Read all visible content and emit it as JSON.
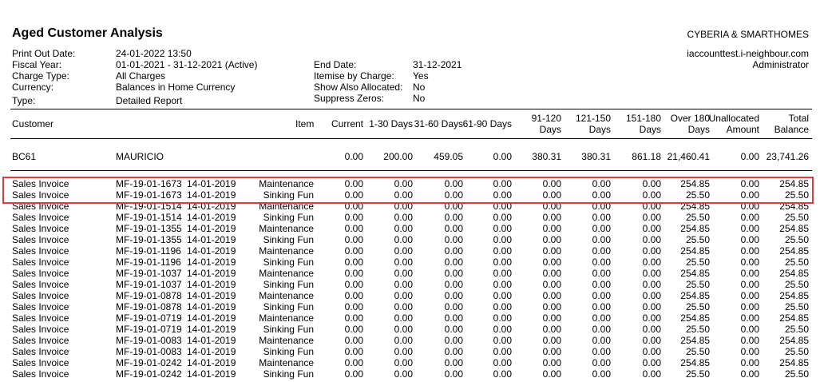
{
  "report": {
    "title": "Aged Customer Analysis",
    "company": "CYBERIA & SMARTHOMES",
    "site": "iaccounttest.i-neighbour.com",
    "role": "Administrator"
  },
  "meta_left": [
    {
      "label": "Print Out Date:",
      "value": "24-01-2022 13:50"
    },
    {
      "label": "Fiscal Year:",
      "value": "01-01-2021 - 31-12-2021 (Active)"
    },
    {
      "label": "Charge Type:",
      "value": "All Charges"
    },
    {
      "label": "Currency:",
      "value": "Balances in Home Currency"
    },
    {
      "label": "Type:",
      "value": "Detailed Report"
    }
  ],
  "meta_mid": [
    {
      "label": "End Date:",
      "value": "31-12-2021"
    },
    {
      "label": "Itemise by Charge:",
      "value": "Yes"
    },
    {
      "label": "Show Also Allocated:",
      "value": "No"
    },
    {
      "label": "Suppress Zeros:",
      "value": "No"
    }
  ],
  "columns": {
    "customer": "Customer",
    "item": "Item",
    "current": "Current",
    "d1_30": "1-30 Days",
    "d31_60": "31-60 Days",
    "d61_90": "61-90 Days",
    "d91_120_a": "91-120",
    "d91_120_b": "Days",
    "d121_150_a": "121-150",
    "d121_150_b": "Days",
    "d151_180_a": "151-180",
    "d151_180_b": "Days",
    "over180_a": "Over 180",
    "over180_b": "Days",
    "unalloc_a": "Unallocated",
    "unalloc_b": "Amount",
    "total_a": "Total",
    "total_b": "Balance"
  },
  "customer": {
    "code": "BC61",
    "name": "MAURICIO",
    "current": "0.00",
    "d1_30": "200.00",
    "d31_60": "459.05",
    "d61_90": "0.00",
    "d91_120": "380.31",
    "d121_150": "380.31",
    "d151_180": "861.18",
    "over180": "21,460.41",
    "unalloc": "0.00",
    "total": "23,741.26"
  },
  "rows": [
    {
      "type": "Sales Invoice",
      "ref": "MF-19-01-1673",
      "date": "14-01-2019",
      "item": "Maintenance",
      "c": "0.00",
      "a": "0.00",
      "b": "0.00",
      "d": "0.00",
      "e": "0.00",
      "f": "0.00",
      "g": "0.00",
      "o": "254.85",
      "u": "0.00",
      "t": "254.85"
    },
    {
      "type": "Sales Invoice",
      "ref": "MF-19-01-1673",
      "date": "14-01-2019",
      "item": "Sinking Fun",
      "c": "0.00",
      "a": "0.00",
      "b": "0.00",
      "d": "0.00",
      "e": "0.00",
      "f": "0.00",
      "g": "0.00",
      "o": "25.50",
      "u": "0.00",
      "t": "25.50"
    },
    {
      "type": "Sales Invoice",
      "ref": "MF-19-01-1514",
      "date": "14-01-2019",
      "item": "Maintenance",
      "c": "0.00",
      "a": "0.00",
      "b": "0.00",
      "d": "0.00",
      "e": "0.00",
      "f": "0.00",
      "g": "0.00",
      "o": "254.85",
      "u": "0.00",
      "t": "254.85"
    },
    {
      "type": "Sales Invoice",
      "ref": "MF-19-01-1514",
      "date": "14-01-2019",
      "item": "Sinking Fun",
      "c": "0.00",
      "a": "0.00",
      "b": "0.00",
      "d": "0.00",
      "e": "0.00",
      "f": "0.00",
      "g": "0.00",
      "o": "25.50",
      "u": "0.00",
      "t": "25.50"
    },
    {
      "type": "Sales Invoice",
      "ref": "MF-19-01-1355",
      "date": "14-01-2019",
      "item": "Maintenance",
      "c": "0.00",
      "a": "0.00",
      "b": "0.00",
      "d": "0.00",
      "e": "0.00",
      "f": "0.00",
      "g": "0.00",
      "o": "254.85",
      "u": "0.00",
      "t": "254.85"
    },
    {
      "type": "Sales Invoice",
      "ref": "MF-19-01-1355",
      "date": "14-01-2019",
      "item": "Sinking Fun",
      "c": "0.00",
      "a": "0.00",
      "b": "0.00",
      "d": "0.00",
      "e": "0.00",
      "f": "0.00",
      "g": "0.00",
      "o": "25.50",
      "u": "0.00",
      "t": "25.50"
    },
    {
      "type": "Sales Invoice",
      "ref": "MF-19-01-1196",
      "date": "14-01-2019",
      "item": "Maintenance",
      "c": "0.00",
      "a": "0.00",
      "b": "0.00",
      "d": "0.00",
      "e": "0.00",
      "f": "0.00",
      "g": "0.00",
      "o": "254.85",
      "u": "0.00",
      "t": "254.85"
    },
    {
      "type": "Sales Invoice",
      "ref": "MF-19-01-1196",
      "date": "14-01-2019",
      "item": "Sinking Fun",
      "c": "0.00",
      "a": "0.00",
      "b": "0.00",
      "d": "0.00",
      "e": "0.00",
      "f": "0.00",
      "g": "0.00",
      "o": "25.50",
      "u": "0.00",
      "t": "25.50"
    },
    {
      "type": "Sales Invoice",
      "ref": "MF-19-01-1037",
      "date": "14-01-2019",
      "item": "Maintenance",
      "c": "0.00",
      "a": "0.00",
      "b": "0.00",
      "d": "0.00",
      "e": "0.00",
      "f": "0.00",
      "g": "0.00",
      "o": "254.85",
      "u": "0.00",
      "t": "254.85"
    },
    {
      "type": "Sales Invoice",
      "ref": "MF-19-01-1037",
      "date": "14-01-2019",
      "item": "Sinking Fun",
      "c": "0.00",
      "a": "0.00",
      "b": "0.00",
      "d": "0.00",
      "e": "0.00",
      "f": "0.00",
      "g": "0.00",
      "o": "25.50",
      "u": "0.00",
      "t": "25.50"
    },
    {
      "type": "Sales Invoice",
      "ref": "MF-19-01-0878",
      "date": "14-01-2019",
      "item": "Maintenance",
      "c": "0.00",
      "a": "0.00",
      "b": "0.00",
      "d": "0.00",
      "e": "0.00",
      "f": "0.00",
      "g": "0.00",
      "o": "254.85",
      "u": "0.00",
      "t": "254.85"
    },
    {
      "type": "Sales Invoice",
      "ref": "MF-19-01-0878",
      "date": "14-01-2019",
      "item": "Sinking Fun",
      "c": "0.00",
      "a": "0.00",
      "b": "0.00",
      "d": "0.00",
      "e": "0.00",
      "f": "0.00",
      "g": "0.00",
      "o": "25.50",
      "u": "0.00",
      "t": "25.50"
    },
    {
      "type": "Sales Invoice",
      "ref": "MF-19-01-0719",
      "date": "14-01-2019",
      "item": "Maintenance",
      "c": "0.00",
      "a": "0.00",
      "b": "0.00",
      "d": "0.00",
      "e": "0.00",
      "f": "0.00",
      "g": "0.00",
      "o": "254.85",
      "u": "0.00",
      "t": "254.85"
    },
    {
      "type": "Sales Invoice",
      "ref": "MF-19-01-0719",
      "date": "14-01-2019",
      "item": "Sinking Fun",
      "c": "0.00",
      "a": "0.00",
      "b": "0.00",
      "d": "0.00",
      "e": "0.00",
      "f": "0.00",
      "g": "0.00",
      "o": "25.50",
      "u": "0.00",
      "t": "25.50"
    },
    {
      "type": "Sales Invoice",
      "ref": "MF-19-01-0083",
      "date": "14-01-2019",
      "item": "Maintenance",
      "c": "0.00",
      "a": "0.00",
      "b": "0.00",
      "d": "0.00",
      "e": "0.00",
      "f": "0.00",
      "g": "0.00",
      "o": "254.85",
      "u": "0.00",
      "t": "254.85"
    },
    {
      "type": "Sales Invoice",
      "ref": "MF-19-01-0083",
      "date": "14-01-2019",
      "item": "Sinking Fun",
      "c": "0.00",
      "a": "0.00",
      "b": "0.00",
      "d": "0.00",
      "e": "0.00",
      "f": "0.00",
      "g": "0.00",
      "o": "25.50",
      "u": "0.00",
      "t": "25.50"
    },
    {
      "type": "Sales Invoice",
      "ref": "MF-19-01-0242",
      "date": "14-01-2019",
      "item": "Maintenance",
      "c": "0.00",
      "a": "0.00",
      "b": "0.00",
      "d": "0.00",
      "e": "0.00",
      "f": "0.00",
      "g": "0.00",
      "o": "254.85",
      "u": "0.00",
      "t": "254.85"
    },
    {
      "type": "Sales Invoice",
      "ref": "MF-19-01-0242",
      "date": "14-01-2019",
      "item": "Sinking Fun",
      "c": "0.00",
      "a": "0.00",
      "b": "0.00",
      "d": "0.00",
      "e": "0.00",
      "f": "0.00",
      "g": "0.00",
      "o": "25.50",
      "u": "0.00",
      "t": "25.50"
    }
  ]
}
